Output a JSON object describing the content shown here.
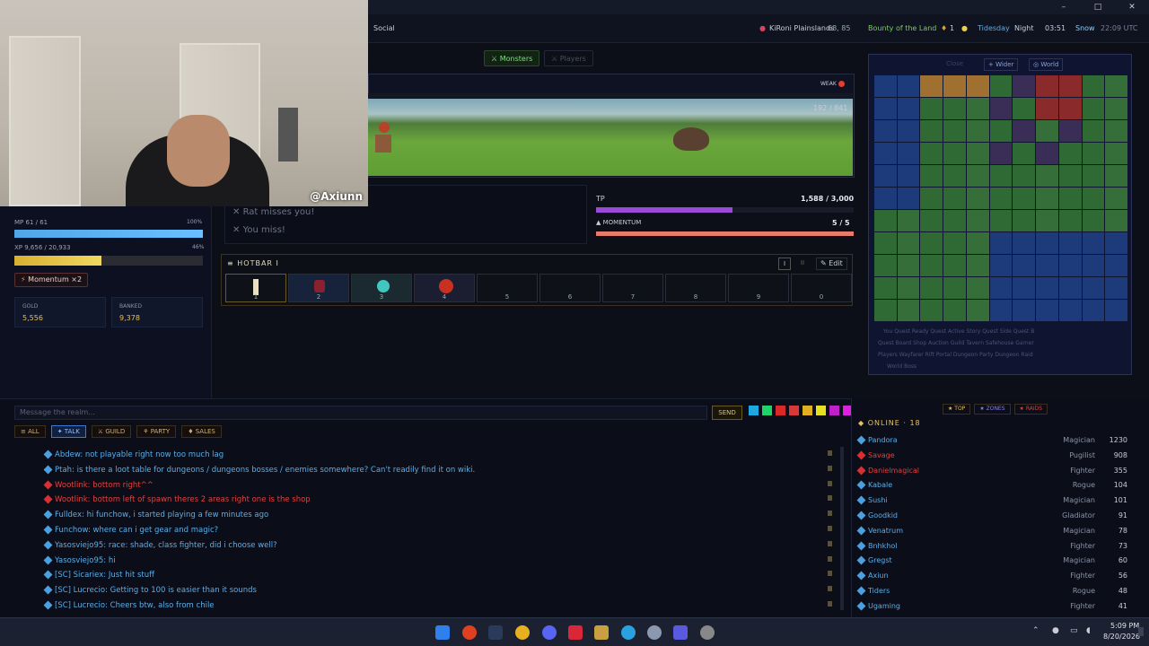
{
  "window": {
    "controls": [
      "–",
      "□",
      "✕"
    ]
  },
  "topbar": {
    "social": "Social",
    "location": "KiRoni Plainslands",
    "coords": "68, 85",
    "buff": "Bounty of the Land",
    "counter": "1",
    "season": "Tidesday",
    "timeofday": "Night",
    "clock": "03:51",
    "weather": "Snow",
    "utc": "22:09 UTC"
  },
  "webcam": {
    "handle": "@Axiunn"
  },
  "left": {
    "mp_label": "MP 61 / 61",
    "mp_pct": "100%",
    "mp_fill": 1.0,
    "xp_label": "XP 9,656 / 20,933",
    "xp_pct": "46%",
    "xp_fill": 0.46,
    "momentum_btn": "Momentum ×2",
    "gold_label": "GOLD",
    "gold_value": "5,556",
    "banked_label": "BANKED",
    "banked_value": "9,378"
  },
  "center": {
    "tab_monsters": "Monsters",
    "tab_players": "Players",
    "weak": "WEAK",
    "enemy_hp": "192 / 841",
    "log1": "Rat misses you!",
    "log2": "You miss!",
    "tp_label": "TP",
    "tp_value": "1,588 / 3,000",
    "tp_fill": 0.53,
    "momentum_label": "MOMENTUM",
    "momentum_value": "5 / 5",
    "momentum_fill": 1.0,
    "hotbar_title": "HOTBAR I",
    "hotbar_tab1": "I",
    "hotbar_tab2": "II",
    "hotbar_edit": "Edit",
    "slots": [
      "1",
      "2",
      "3",
      "4",
      "5",
      "6",
      "7",
      "8",
      "9",
      "0"
    ]
  },
  "map": {
    "btn_close": "Close",
    "btn_wider": "Wider",
    "btn_world": "World",
    "legend1": "You  Quest Ready  Quest Active  Story Quest  Side Quest  B",
    "legend2": "Quest Board  Shop  Auction  Guild  Tavern  Safehouse  Garner",
    "legend3": "Players  Wayfarer  Rift Portal  Dungeon  Party Dungeon  Raid",
    "legend4": "World Boss"
  },
  "chat": {
    "placeholder": "Message the realm...",
    "send": "SEND",
    "colors": [
      "#1fa8e0",
      "#1fd36a",
      "#d82828",
      "#d83838",
      "#e0b020",
      "#e6e020",
      "#c020c8",
      "#e020e0"
    ],
    "tabs": [
      "ALL",
      "TALK",
      "GUILD",
      "PARTY",
      "SALES"
    ],
    "lines": [
      {
        "text": "Abdew: not playable right now too much lag",
        "color": "#5aaee8"
      },
      {
        "text": "Ptah: is there a loot table for dungeons / dungeons bosses / enemies somewhere? Can't readily find it on wiki.",
        "color": "#5aaee8"
      },
      {
        "text": "Wootlink: bottom right^^",
        "color": "#e04040"
      },
      {
        "text": "Wootlink: bottom left of spawn theres 2 areas right one is the shop",
        "color": "#e04040"
      },
      {
        "text": "Fulldex: hi funchow, i started playing a few minutes ago",
        "color": "#5aaee8"
      },
      {
        "text": "Funchow: where can i get gear and magic?",
        "color": "#5aaee8"
      },
      {
        "text": "Yasosviejo95: race: shade, class fighter, did i choose well?",
        "color": "#5aaee8"
      },
      {
        "text": "Yasosviejo95: hi",
        "color": "#5aaee8"
      },
      {
        "text": "[SC] Sicariex: Just hit stuff",
        "color": "#5aaee8"
      },
      {
        "text": "[SC] Lucrecio: Getting to 100 is easier than it sounds",
        "color": "#5aaee8"
      },
      {
        "text": "[SC] Lucrecio: Cheers btw, also from chile",
        "color": "#5aaee8"
      }
    ]
  },
  "online": {
    "tabs": [
      "TOP",
      "ZONES",
      "RAIDS"
    ],
    "header": "ONLINE · 18",
    "players": [
      {
        "name": "Pandora",
        "cls": "Magician",
        "lvl": "1230",
        "color": "#5aaee8"
      },
      {
        "name": "Savage",
        "cls": "Pugilist",
        "lvl": "908",
        "color": "#e04040"
      },
      {
        "name": "Danielmagical",
        "cls": "Fighter",
        "lvl": "355",
        "color": "#e04040"
      },
      {
        "name": "Kabale",
        "cls": "Rogue",
        "lvl": "104",
        "color": "#5aaee8"
      },
      {
        "name": "Sushi",
        "cls": "Magician",
        "lvl": "101",
        "color": "#5aaee8"
      },
      {
        "name": "Goodkid",
        "cls": "Gladiator",
        "lvl": "91",
        "color": "#5aaee8"
      },
      {
        "name": "Venatrum",
        "cls": "Magician",
        "lvl": "78",
        "color": "#5aaee8"
      },
      {
        "name": "Bnhkhol",
        "cls": "Fighter",
        "lvl": "73",
        "color": "#5aaee8"
      },
      {
        "name": "Gregst",
        "cls": "Magician",
        "lvl": "60",
        "color": "#5aaee8"
      },
      {
        "name": "Axiun",
        "cls": "Fighter",
        "lvl": "56",
        "color": "#5aaee8"
      },
      {
        "name": "Tiders",
        "cls": "Rogue",
        "lvl": "48",
        "color": "#5aaee8"
      },
      {
        "name": "Ugaming",
        "cls": "Fighter",
        "lvl": "41",
        "color": "#5aaee8"
      }
    ]
  },
  "taskbar": {
    "time": "5:09 PM",
    "date": "8/20/2026"
  }
}
